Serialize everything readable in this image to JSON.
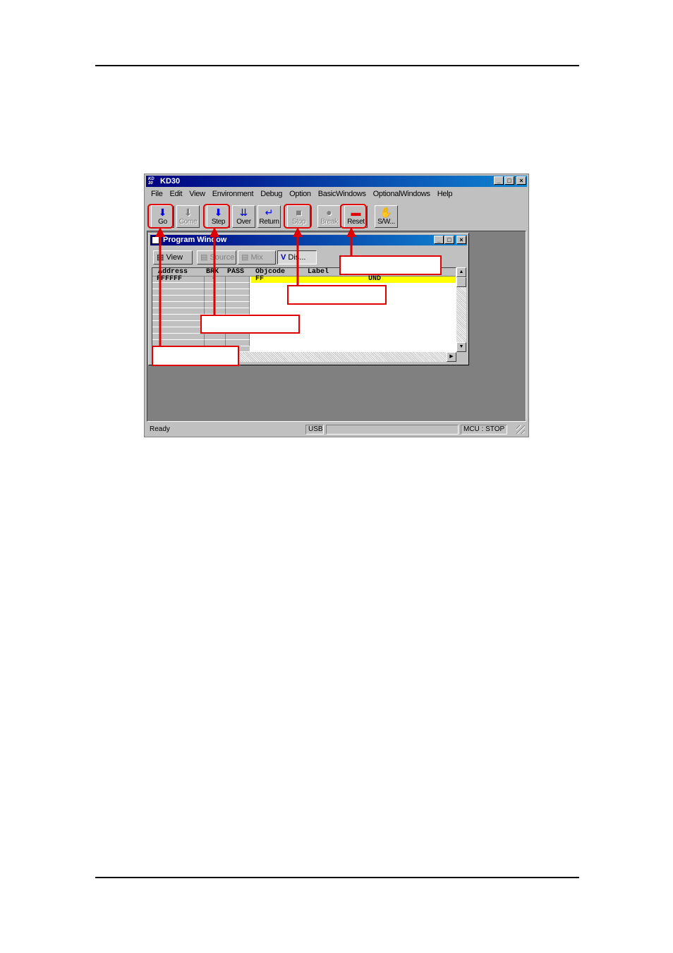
{
  "app": {
    "title": "KD30",
    "icon_text": "KD 30",
    "caption_buttons": {
      "minimize": "_",
      "maximize": "□",
      "close": "×"
    }
  },
  "menu": [
    "File",
    "Edit",
    "View",
    "Environment",
    "Debug",
    "Option",
    "BasicWindows",
    "OptionalWindows",
    "Help"
  ],
  "toolbar": {
    "go": "Go",
    "come": "Come",
    "step": "Step",
    "over": "Over",
    "return": "Return",
    "stop": "Stop",
    "break": "Break",
    "reset": "Reset",
    "sw": "S/W..."
  },
  "program_window": {
    "title": "Program Window",
    "buttons": {
      "view": "View",
      "source": "Source",
      "mix": "Mix",
      "dis": "Dis..."
    },
    "columns": {
      "address": "Address",
      "brk": "BRK",
      "pass": "PASS",
      "objcode": "Objcode",
      "label": "Label"
    },
    "row": {
      "address": "FFFFFF",
      "brk": "-",
      "objcode": "FF",
      "mnemonic": "UND"
    }
  },
  "status": {
    "ready": "Ready",
    "usb": "USB",
    "mcu": "MCU : STOP"
  },
  "colors": {
    "annotation": "#e00000",
    "title_active": "#000080",
    "highlight_row": "#ffff00"
  }
}
